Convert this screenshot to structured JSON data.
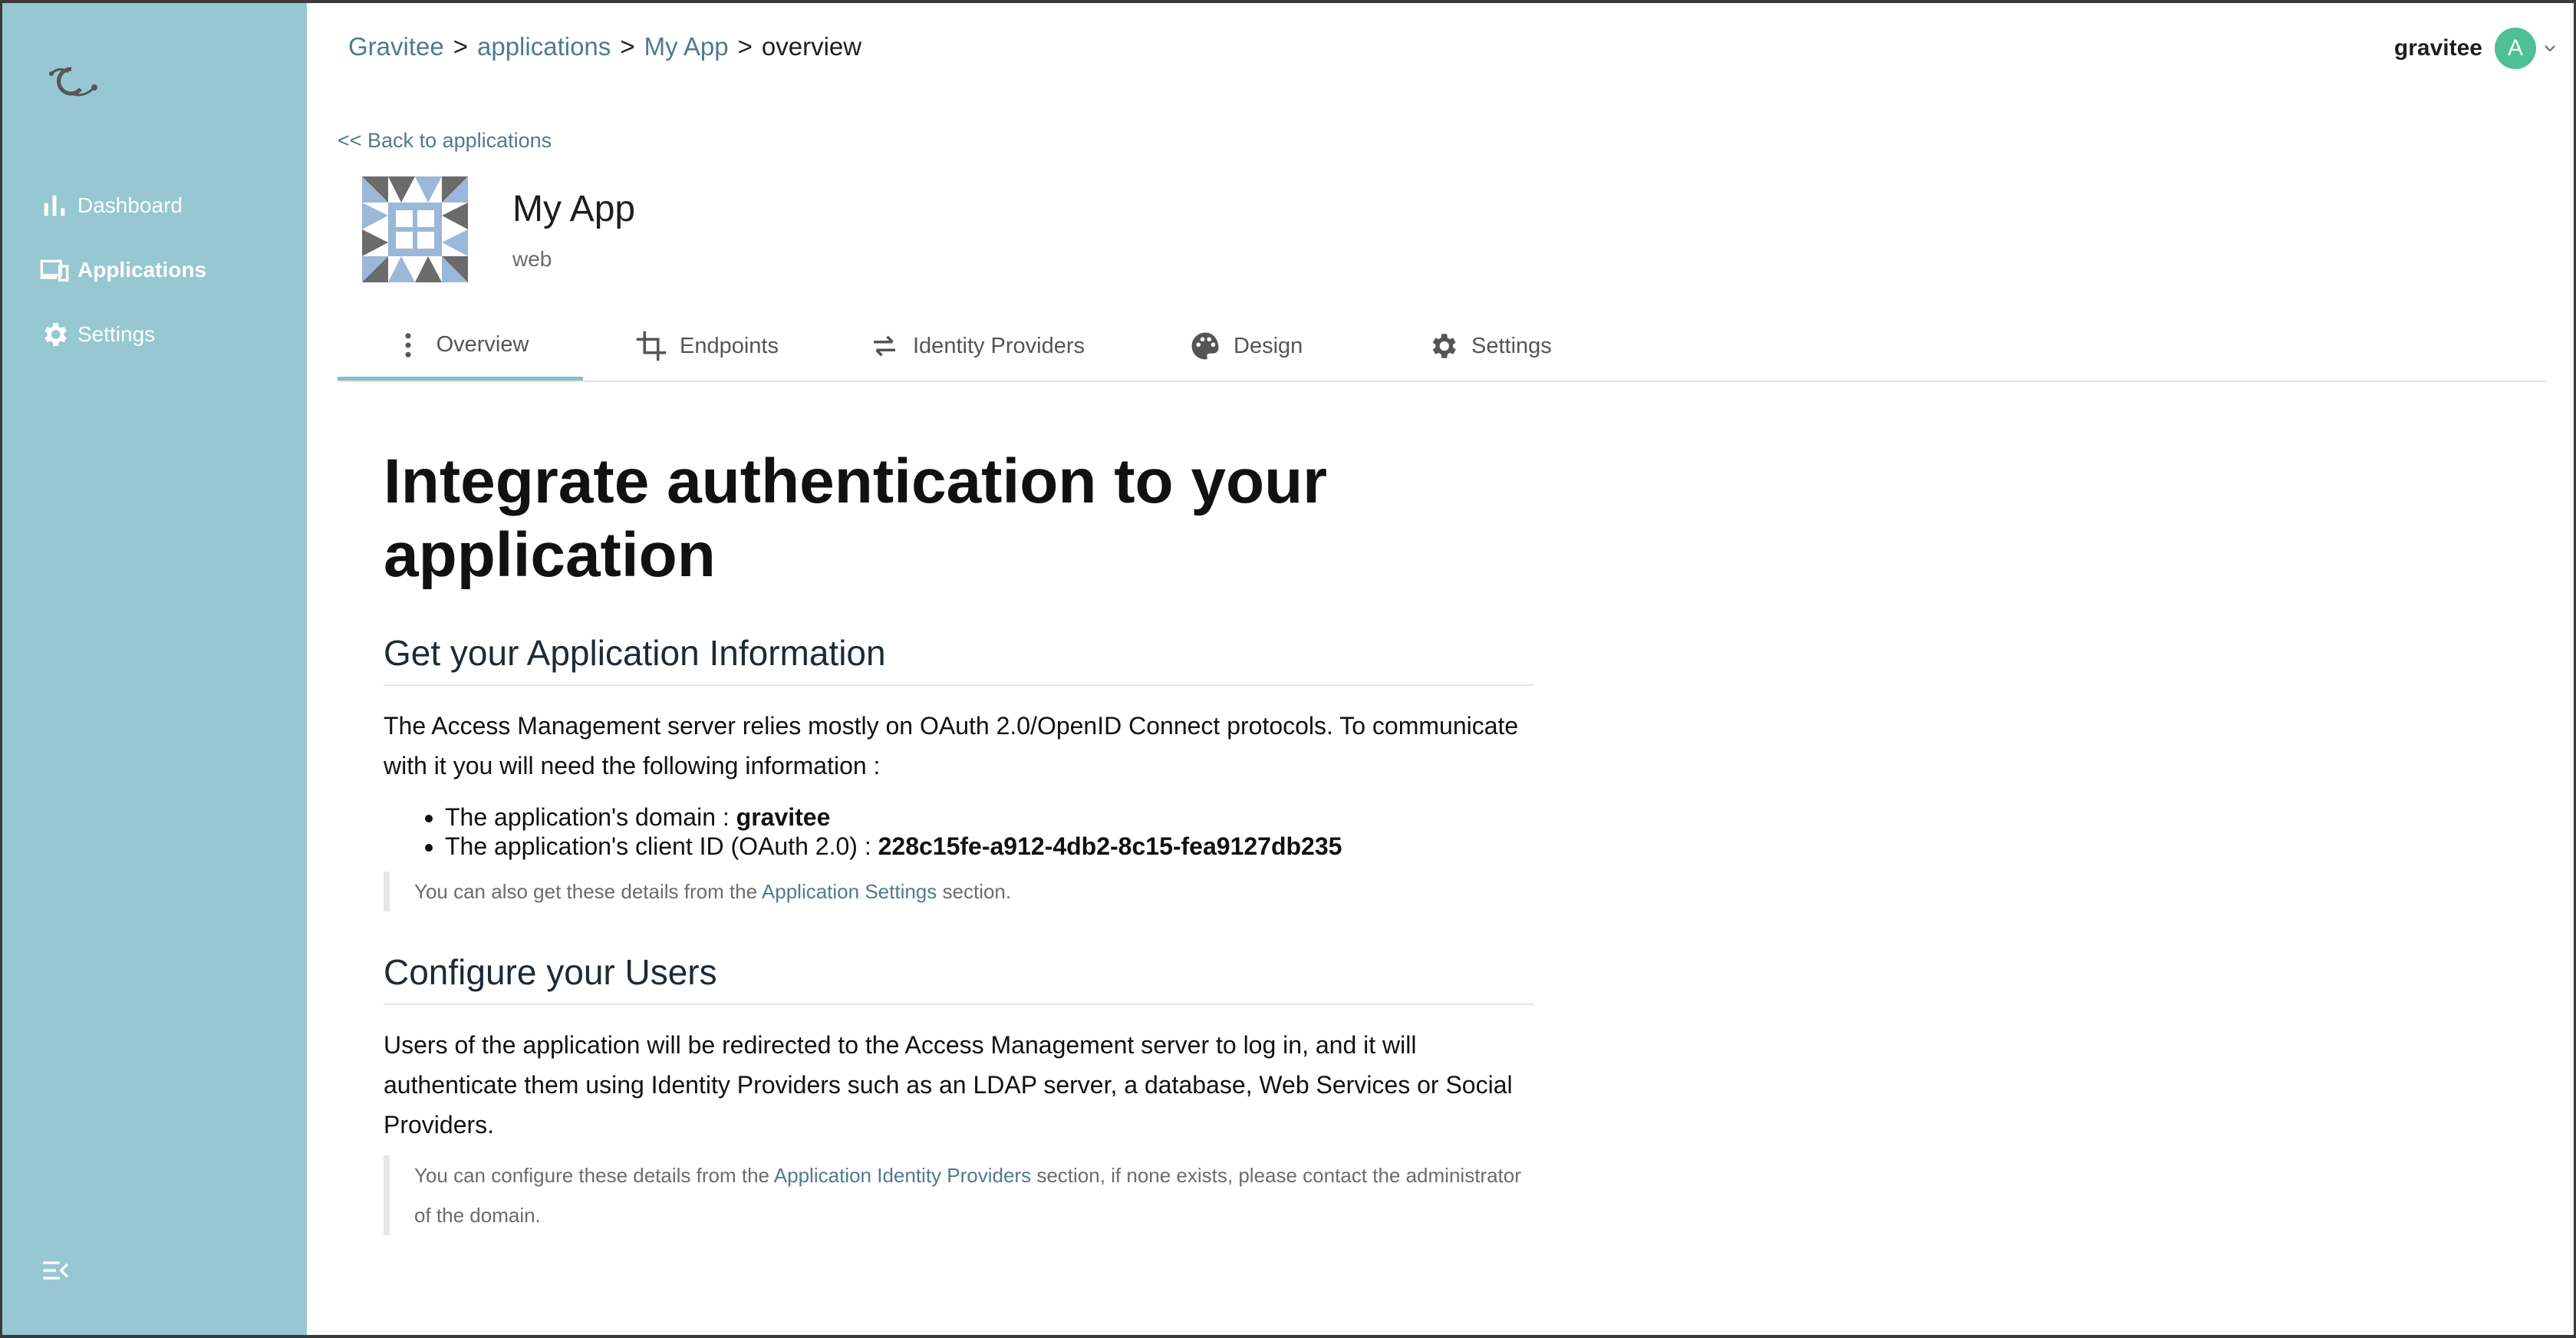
{
  "sidebar": {
    "items": [
      {
        "label": "Dashboard",
        "icon": "bar-chart-icon"
      },
      {
        "label": "Applications",
        "icon": "devices-icon"
      },
      {
        "label": "Settings",
        "icon": "gear-icon"
      }
    ]
  },
  "breadcrumb": {
    "items": [
      "Gravitee",
      "applications",
      "My App",
      "overview"
    ],
    "separator": ">"
  },
  "user": {
    "name": "gravitee",
    "avatar_initial": "A"
  },
  "back_link": "<< Back to applications",
  "app": {
    "name": "My App",
    "type": "web"
  },
  "tabs": [
    {
      "label": "Overview",
      "icon": "more-vert-icon"
    },
    {
      "label": "Endpoints",
      "icon": "crop-icon"
    },
    {
      "label": "Identity Providers",
      "icon": "swap-horiz-icon"
    },
    {
      "label": "Design",
      "icon": "palette-icon"
    },
    {
      "label": "Settings",
      "icon": "gear-icon"
    }
  ],
  "content": {
    "title": "Integrate authentication to your application",
    "section1": {
      "heading": "Get your Application Information",
      "paragraph": "The Access Management server relies mostly on OAuth 2.0/OpenID Connect protocols. To communicate with it you will need the following information :",
      "domain_label": "The application's domain : ",
      "domain_value": "gravitee",
      "client_label": "The application's client ID (OAuth 2.0) : ",
      "client_value": "228c15fe-a912-4db2-8c15-fea9127db235",
      "note_before": "You can also get these details from the ",
      "note_link": "Application Settings",
      "note_after": " section."
    },
    "section2": {
      "heading": "Configure your Users",
      "paragraph": "Users of the application will be redirected to the Access Management server to log in, and it will authenticate them using Identity Providers such as an LDAP server, a database, Web Services or Social Providers.",
      "note_before": "You can configure these details from the ",
      "note_link": "Application Identity Providers",
      "note_after": " section, if none exists, please contact the administrator of the domain."
    }
  },
  "colors": {
    "sidebar": "#96c7d3",
    "link": "#4f7b8d",
    "avatar": "#4ebf97",
    "tab_active_underline": "#8cbccb"
  }
}
